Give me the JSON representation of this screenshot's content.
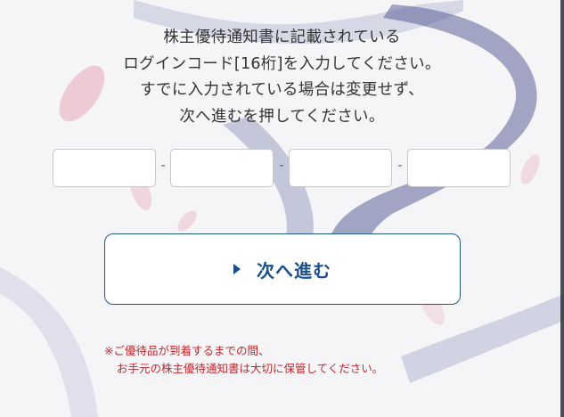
{
  "instructions": {
    "line1": "株主優待通知書に記載されている",
    "line2": "ログインコード[16桁]を入力してください。",
    "line3": "すでに入力されている場合は変更せず、",
    "line4": "次へ進むを押してください。"
  },
  "login_code": {
    "fields": [
      {
        "value": "",
        "placeholder": ""
      },
      {
        "value": "",
        "placeholder": ""
      },
      {
        "value": "",
        "placeholder": ""
      },
      {
        "value": "",
        "placeholder": ""
      }
    ],
    "separator": "-"
  },
  "next_button": {
    "label": "次へ進む",
    "icon": "caret-right-icon"
  },
  "notice": {
    "line1": "※ご優待品が到着するまでの間、",
    "line2": "お手元の株主優待通知書は大切に保管してください。",
    "color": "#c2272d"
  },
  "colors": {
    "accent": "#1b4f8c",
    "text": "#333333"
  }
}
